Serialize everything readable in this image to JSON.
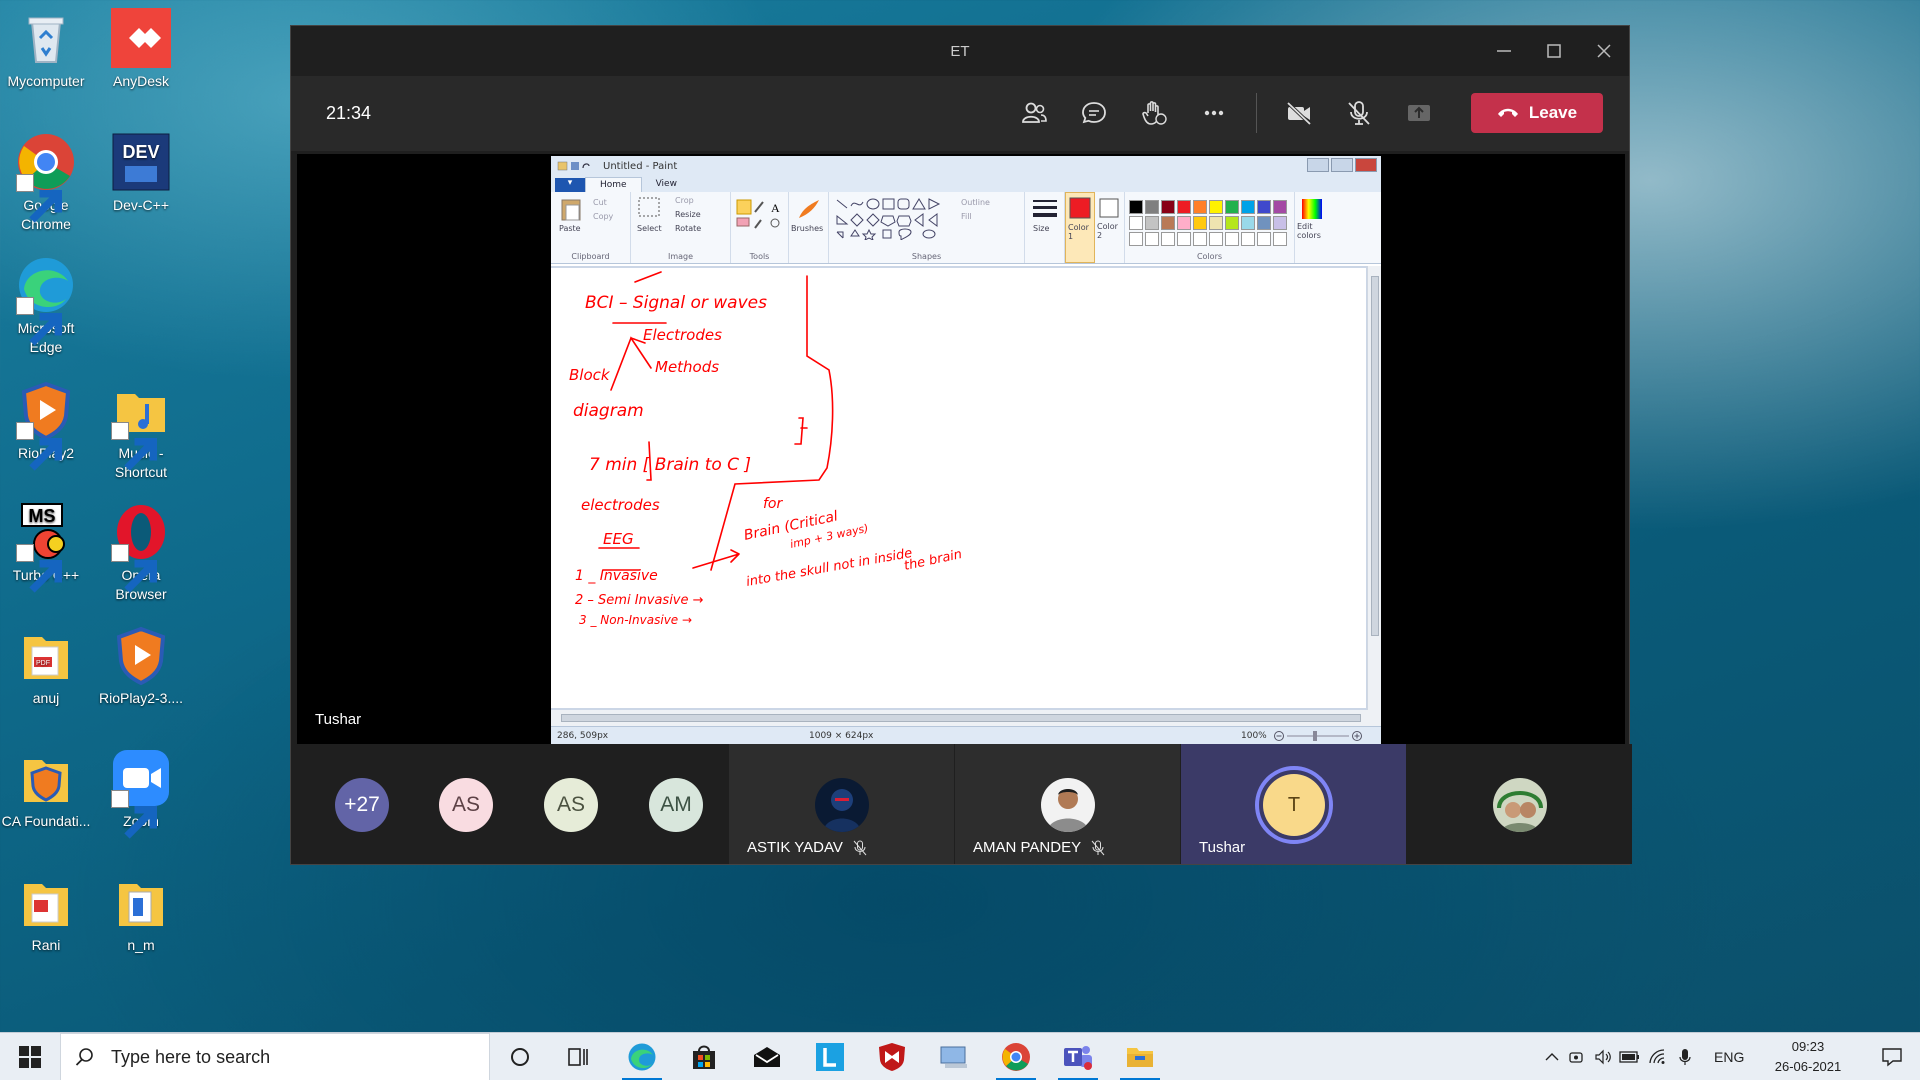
{
  "desktop": {
    "icons": [
      {
        "label": "Mycomputer"
      },
      {
        "label": "AnyDesk"
      },
      {
        "label": "Google Chrome"
      },
      {
        "label": "Dev-C++"
      },
      {
        "label": "Microsoft Edge"
      },
      {
        "label": "RioPlay2"
      },
      {
        "label": "Music - Shortcut"
      },
      {
        "label": "Turbo C++"
      },
      {
        "label": "Opera Browser"
      },
      {
        "label": "anuj"
      },
      {
        "label": "RioPlay2-3...."
      },
      {
        "label": "CA Foundati..."
      },
      {
        "label": "Zoom"
      },
      {
        "label": "Rani"
      },
      {
        "label": "n_m"
      }
    ]
  },
  "teams": {
    "window_title": "ET",
    "timer": "21:34",
    "leave_label": "Leave",
    "presenter_name": "Tushar",
    "colors": {
      "leave": "#c4314b",
      "active_tile": "#3b3a67",
      "ring": "#7f85f5"
    },
    "participants": {
      "overflow": "+27",
      "initials": [
        "AS",
        "AS",
        "AM"
      ],
      "tiles": [
        {
          "name": "ASTIK YADAV",
          "muted": true
        },
        {
          "name": "AMAN PANDEY",
          "muted": true
        },
        {
          "name": "Tushar",
          "initial": "T"
        }
      ]
    }
  },
  "paint": {
    "title": "Untitled - Paint",
    "tabs": [
      "Home",
      "View"
    ],
    "clipboard": {
      "paste": "Paste",
      "cut": "Cut",
      "copy": "Copy",
      "group": "Clipboard"
    },
    "image": {
      "select": "Select",
      "crop": "Crop",
      "resize": "Resize",
      "rotate": "Rotate",
      "group": "Image"
    },
    "tools_group": "Tools",
    "brushes": "Brushes",
    "shapes": {
      "outline": "Outline",
      "fill": "Fill",
      "group": "Shapes"
    },
    "size": "Size",
    "color1": "Color 1",
    "color2": "Color 2",
    "colors_group": "Colors",
    "edit_colors": "Edit colors",
    "status": {
      "cursor": "286, 509px",
      "canvas_size": "1009 × 624px",
      "zoom": "100%"
    },
    "handwriting": [
      "BCI – Signal or waves",
      "Electrodes",
      "Block",
      "Methods",
      "diagram",
      "7 min [ Brain to C ]",
      "electrodes",
      "EEG",
      "for",
      "Brain (Critical",
      "imp + 3 ways)",
      "1 _ Invasive",
      "2 – Semi Invasive →",
      "into the skull not in inside",
      "the brain",
      "3 _ Non-Invasive →"
    ]
  },
  "taskbar": {
    "search_placeholder": "Type here to search",
    "language": "ENG",
    "time": "09:23",
    "date": "26-06-2021"
  }
}
